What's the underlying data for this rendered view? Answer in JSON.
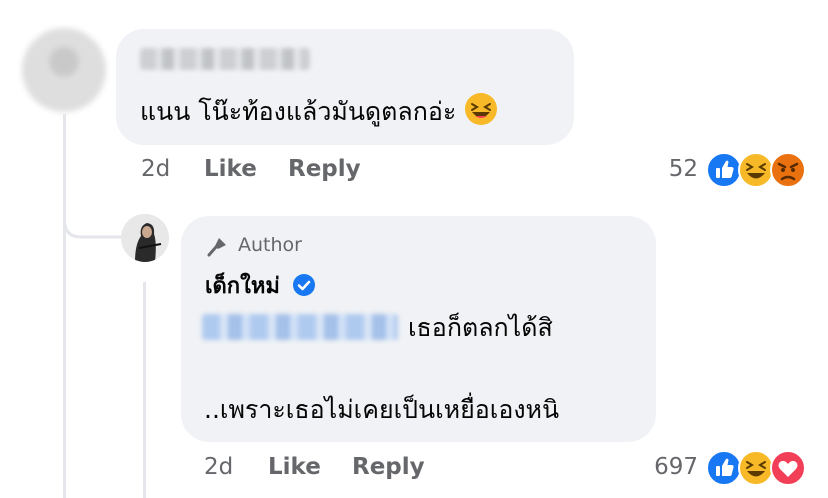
{
  "comment": {
    "text": "แนน โน๊ะท้องแล้วมันดูตลกอ่ะ",
    "emoji": "laughing-emoji",
    "time": "2d",
    "like_label": "Like",
    "reply_label": "Reply",
    "reaction_count": "52",
    "reactions": [
      "like",
      "haha",
      "angry"
    ]
  },
  "reply": {
    "badge_label": "Author",
    "name": "เด็กใหม่",
    "verified": true,
    "text_line1": "เธอก็ตลกได้สิ",
    "text_line2": "..เพราะเธอไม่เคยเป็นเหยื่อเองหนิ",
    "time": "2d",
    "like_label": "Like",
    "reply_label": "Reply",
    "reaction_count": "697",
    "reactions": [
      "like",
      "haha",
      "love"
    ]
  },
  "colors": {
    "bubble": "#f0f2f5",
    "meta_text": "#65676b",
    "like_blue": "#1877f2",
    "haha_yellow": "#f7b928",
    "angry_orange": "#e9710f",
    "love_red": "#f33e58"
  }
}
